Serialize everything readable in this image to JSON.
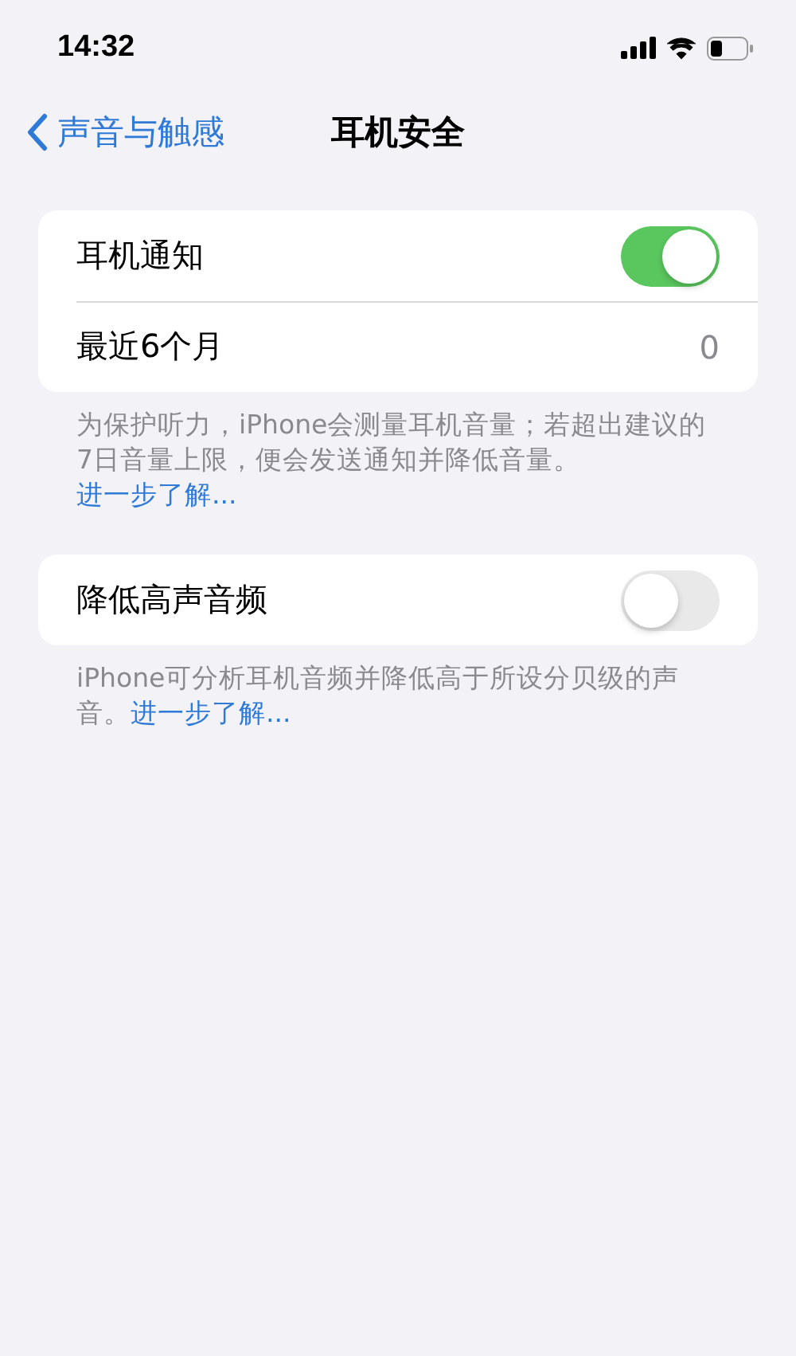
{
  "status_bar": {
    "time": "14:32"
  },
  "nav": {
    "back": "声音与触感",
    "title": "耳机安全"
  },
  "sections": [
    {
      "rows": [
        {
          "kind": "toggle",
          "label": "耳机通知",
          "on": true
        },
        {
          "kind": "value",
          "label": "最近6个月",
          "value": "0"
        }
      ],
      "footer": {
        "text": "为保护听力，iPhone会测量耳机音量；若超出建议的7日音量上限，便会发送通知并降低音量。",
        "link": "进一步了解..."
      }
    },
    {
      "rows": [
        {
          "kind": "toggle",
          "label": "降低高声音频",
          "on": false
        }
      ],
      "footer": {
        "text": "iPhone可分析耳机音频并降低高于所设分贝级的声音。",
        "link": "进一步了解..."
      }
    }
  ]
}
